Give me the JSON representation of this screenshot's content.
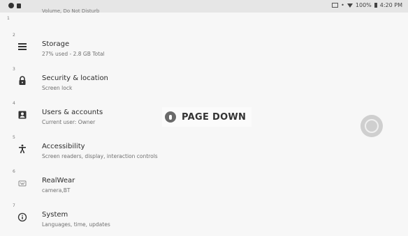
{
  "status_bar": {
    "battery": "100%",
    "time": "4:20 PM",
    "icons": [
      "cast-icon",
      "wifi-icon",
      "battery-icon"
    ]
  },
  "partial_top_item": {
    "subtitle": "Volume, Do Not Disturb"
  },
  "first_number": "1",
  "settings": [
    {
      "number": "2",
      "icon": "storage-icon",
      "title": "Storage",
      "subtitle": "27% used - 2.8 GB Total"
    },
    {
      "number": "3",
      "icon": "lock-icon",
      "title": "Security & location",
      "subtitle": "Screen lock"
    },
    {
      "number": "4",
      "icon": "account-box-icon",
      "title": "Users & accounts",
      "subtitle": "Current user: Owner"
    },
    {
      "number": "5",
      "icon": "accessibility-icon",
      "title": "Accessibility",
      "subtitle": "Screen readers, display, interaction controls"
    },
    {
      "number": "6",
      "icon": "realwear-icon",
      "title": "RealWear",
      "subtitle": "camera,BT"
    },
    {
      "number": "7",
      "icon": "info-icon",
      "title": "System",
      "subtitle": "Languages, time, updates"
    }
  ],
  "voice_hint": {
    "label": "PAGE DOWN",
    "icon": "mic-icon"
  },
  "navigation_button": {
    "icon": "navigation-pad-icon"
  }
}
